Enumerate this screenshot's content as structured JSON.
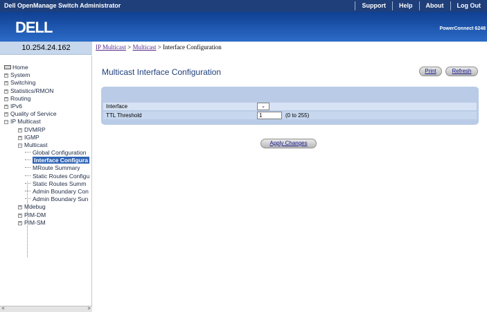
{
  "header": {
    "app_title": "Dell OpenManage Switch Administrator",
    "nav": [
      "Support",
      "Help",
      "About",
      "Log Out"
    ],
    "product": "PowerConnect 6248"
  },
  "logo": {
    "text": "DELL"
  },
  "address": "10.254.24.162",
  "breadcrumb": {
    "items": [
      "IP Multicast",
      "Multicast"
    ],
    "current": "Interface Configuration",
    "separator": ">"
  },
  "sidebar": {
    "items": [
      {
        "label": "Home",
        "indent": 0,
        "icon": "home-icon"
      },
      {
        "label": "System",
        "indent": 0,
        "icon": "expand-icon"
      },
      {
        "label": "Switching",
        "indent": 0,
        "icon": "expand-icon"
      },
      {
        "label": "Statistics/RMON",
        "indent": 0,
        "icon": "expand-icon"
      },
      {
        "label": "Routing",
        "indent": 0,
        "icon": "expand-icon"
      },
      {
        "label": "IPv6",
        "indent": 0,
        "icon": "expand-icon"
      },
      {
        "label": "Quality of Service",
        "indent": 0,
        "icon": "expand-icon"
      },
      {
        "label": "IP Multicast",
        "indent": 0,
        "icon": "collapse-icon"
      },
      {
        "label": "DVMRP",
        "indent": 1,
        "icon": "expand-icon"
      },
      {
        "label": "IGMP",
        "indent": 1,
        "icon": "expand-icon"
      },
      {
        "label": "Multicast",
        "indent": 1,
        "icon": "collapse-icon"
      },
      {
        "label": "Global Configuration",
        "indent": 2,
        "icon": ""
      },
      {
        "label": "Interface Configura",
        "indent": 2,
        "icon": "",
        "selected": true
      },
      {
        "label": "MRoute Summary",
        "indent": 2,
        "icon": ""
      },
      {
        "label": "Static Routes Configu",
        "indent": 2,
        "icon": ""
      },
      {
        "label": "Static Routes Summ",
        "indent": 2,
        "icon": ""
      },
      {
        "label": "Admin Boundary Con",
        "indent": 2,
        "icon": ""
      },
      {
        "label": "Admin Boundary Sun",
        "indent": 2,
        "icon": ""
      },
      {
        "label": "Mdebug",
        "indent": 1,
        "icon": "expand-icon"
      },
      {
        "label": "PIM-DM",
        "indent": 1,
        "icon": "expand-icon"
      },
      {
        "label": "PIM-SM",
        "indent": 1,
        "icon": "expand-icon"
      }
    ]
  },
  "main": {
    "title": "Multicast Interface Configuration",
    "print_label": "Print",
    "refresh_label": "Refresh",
    "form": {
      "interface_label": "Interface",
      "interface_value": "",
      "ttl_label": "TTL Threshold",
      "ttl_value": "1",
      "ttl_hint": "(0 to 255)"
    },
    "apply_label": "Apply Changes"
  },
  "colors": {
    "topbar": "#1f3f7a",
    "banner": "#2c6cc8",
    "panel": "#b9cbe6",
    "selected": "#2f64b5"
  }
}
